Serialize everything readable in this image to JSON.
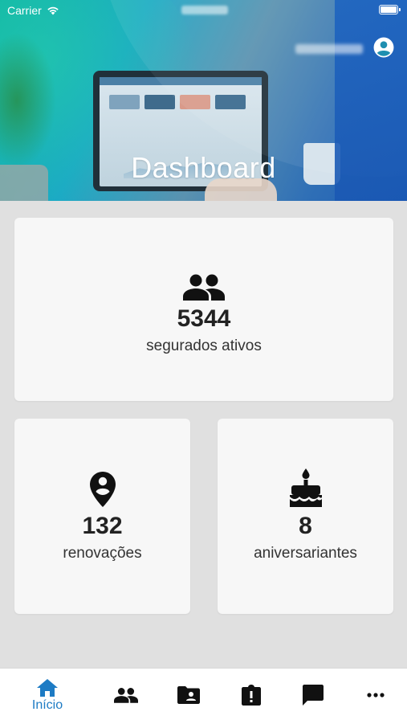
{
  "status_bar": {
    "carrier": "Carrier"
  },
  "header": {
    "title": "Dashboard"
  },
  "cards": {
    "insured": {
      "value": "5344",
      "label": "segurados ativos",
      "icon": "group-icon"
    },
    "renewals": {
      "value": "132",
      "label": "renovações",
      "icon": "location-pin-icon"
    },
    "birthdays": {
      "value": "8",
      "label": "aniversariantes",
      "icon": "birthday-cake-icon"
    }
  },
  "tabbar": {
    "active_color": "#1d7bc4",
    "items": [
      {
        "label": "Início",
        "icon": "home-icon",
        "active": true
      },
      {
        "label": "",
        "icon": "people-icon",
        "active": false
      },
      {
        "label": "",
        "icon": "contact-folder-icon",
        "active": false
      },
      {
        "label": "",
        "icon": "clipboard-alert-icon",
        "active": false
      },
      {
        "label": "",
        "icon": "chat-icon",
        "active": false
      },
      {
        "label": "",
        "icon": "more-icon",
        "active": false
      }
    ]
  }
}
